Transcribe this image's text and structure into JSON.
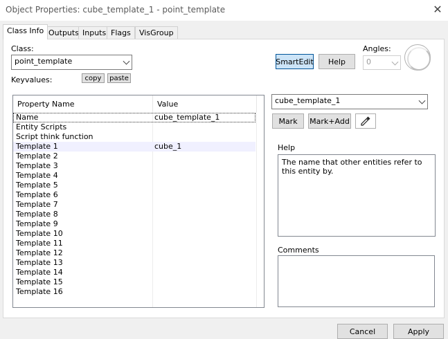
{
  "window": {
    "title": "Object Properties: cube_template_1 - point_template",
    "close_glyph": "✕"
  },
  "tabs": [
    {
      "label": "Class Info",
      "active": true
    },
    {
      "label": "Outputs"
    },
    {
      "label": "Inputs"
    },
    {
      "label": "Flags"
    },
    {
      "label": "VisGroup"
    }
  ],
  "class_section": {
    "label": "Class:",
    "value": "point_template",
    "keyvalues_label": "Keyvalues:",
    "copy_label": "copy",
    "paste_label": "paste"
  },
  "toolbar": {
    "smartedit_label": "SmartEdit",
    "help_label": "Help",
    "angles_label": "Angles:",
    "angles_value": "0"
  },
  "table": {
    "headers": [
      "Property Name",
      "Value"
    ],
    "rows": [
      {
        "name": "Name",
        "value": "cube_template_1",
        "focused": true
      },
      {
        "name": "Entity Scripts",
        "value": ""
      },
      {
        "name": "Script think function",
        "value": ""
      },
      {
        "name": "Template 1",
        "value": "cube_1",
        "selected": true
      },
      {
        "name": "Template 2",
        "value": ""
      },
      {
        "name": "Template 3",
        "value": ""
      },
      {
        "name": "Template 4",
        "value": ""
      },
      {
        "name": "Template 5",
        "value": ""
      },
      {
        "name": "Template 6",
        "value": ""
      },
      {
        "name": "Template 7",
        "value": ""
      },
      {
        "name": "Template 8",
        "value": ""
      },
      {
        "name": "Template 9",
        "value": ""
      },
      {
        "name": "Template 10",
        "value": ""
      },
      {
        "name": "Template 11",
        "value": ""
      },
      {
        "name": "Template 12",
        "value": ""
      },
      {
        "name": "Template 13",
        "value": ""
      },
      {
        "name": "Template 14",
        "value": ""
      },
      {
        "name": "Template 15",
        "value": ""
      },
      {
        "name": "Template 16",
        "value": ""
      }
    ]
  },
  "value_editor": {
    "value": "cube_template_1",
    "mark_label": "Mark",
    "mark_add_label": "Mark+Add",
    "eyedropper_icon": "eyedropper-icon"
  },
  "help_panel": {
    "label": "Help",
    "text": "The name that other entities refer to this entity by."
  },
  "comments_panel": {
    "label": "Comments",
    "text": ""
  },
  "footer": {
    "cancel_label": "Cancel",
    "apply_label": "Apply"
  }
}
